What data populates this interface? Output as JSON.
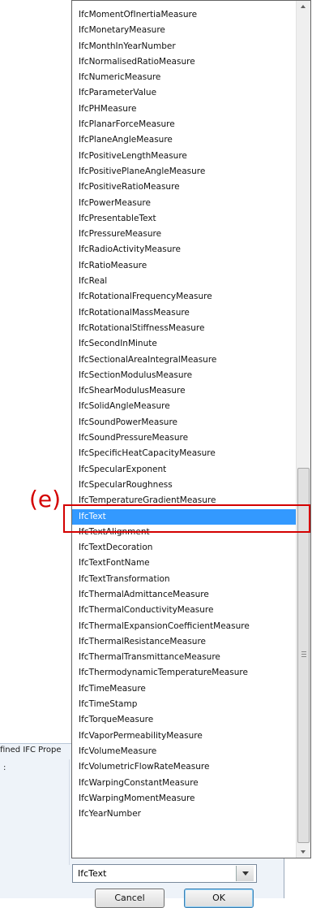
{
  "annotation": {
    "label": "(e)"
  },
  "dialog": {
    "title": "fined IFC Prope",
    "field_label": ":"
  },
  "dropdown": {
    "items": [
      "IfcMomentOfInertiaMeasure",
      "IfcMonetaryMeasure",
      "IfcMonthInYearNumber",
      "IfcNormalisedRatioMeasure",
      "IfcNumericMeasure",
      "IfcParameterValue",
      "IfcPHMeasure",
      "IfcPlanarForceMeasure",
      "IfcPlaneAngleMeasure",
      "IfcPositiveLengthMeasure",
      "IfcPositivePlaneAngleMeasure",
      "IfcPositiveRatioMeasure",
      "IfcPowerMeasure",
      "IfcPresentableText",
      "IfcPressureMeasure",
      "IfcRadioActivityMeasure",
      "IfcRatioMeasure",
      "IfcReal",
      "IfcRotationalFrequencyMeasure",
      "IfcRotationalMassMeasure",
      "IfcRotationalStiffnessMeasure",
      "IfcSecondInMinute",
      "IfcSectionalAreaIntegralMeasure",
      "IfcSectionModulusMeasure",
      "IfcShearModulusMeasure",
      "IfcSolidAngleMeasure",
      "IfcSoundPowerMeasure",
      "IfcSoundPressureMeasure",
      "IfcSpecificHeatCapacityMeasure",
      "IfcSpecularExponent",
      "IfcSpecularRoughness",
      "IfcTemperatureGradientMeasure",
      "IfcText",
      "IfcTextAlignment",
      "IfcTextDecoration",
      "IfcTextFontName",
      "IfcTextTransformation",
      "IfcThermalAdmittanceMeasure",
      "IfcThermalConductivityMeasure",
      "IfcThermalExpansionCoefficientMeasure",
      "IfcThermalResistanceMeasure",
      "IfcThermalTransmittanceMeasure",
      "IfcThermodynamicTemperatureMeasure",
      "IfcTimeMeasure",
      "IfcTimeStamp",
      "IfcTorqueMeasure",
      "IfcVaporPermeabilityMeasure",
      "IfcVolumeMeasure",
      "IfcVolumetricFlowRateMeasure",
      "IfcWarpingConstantMeasure",
      "IfcWarpingMomentMeasure",
      "IfcYearNumber"
    ],
    "selected_index": 32
  },
  "combobox": {
    "value": "IfcText"
  },
  "buttons": {
    "cancel_label": "Cancel",
    "ok_label": "OK"
  },
  "colors": {
    "selection": "#3399ff",
    "annotation": "#d40000"
  }
}
